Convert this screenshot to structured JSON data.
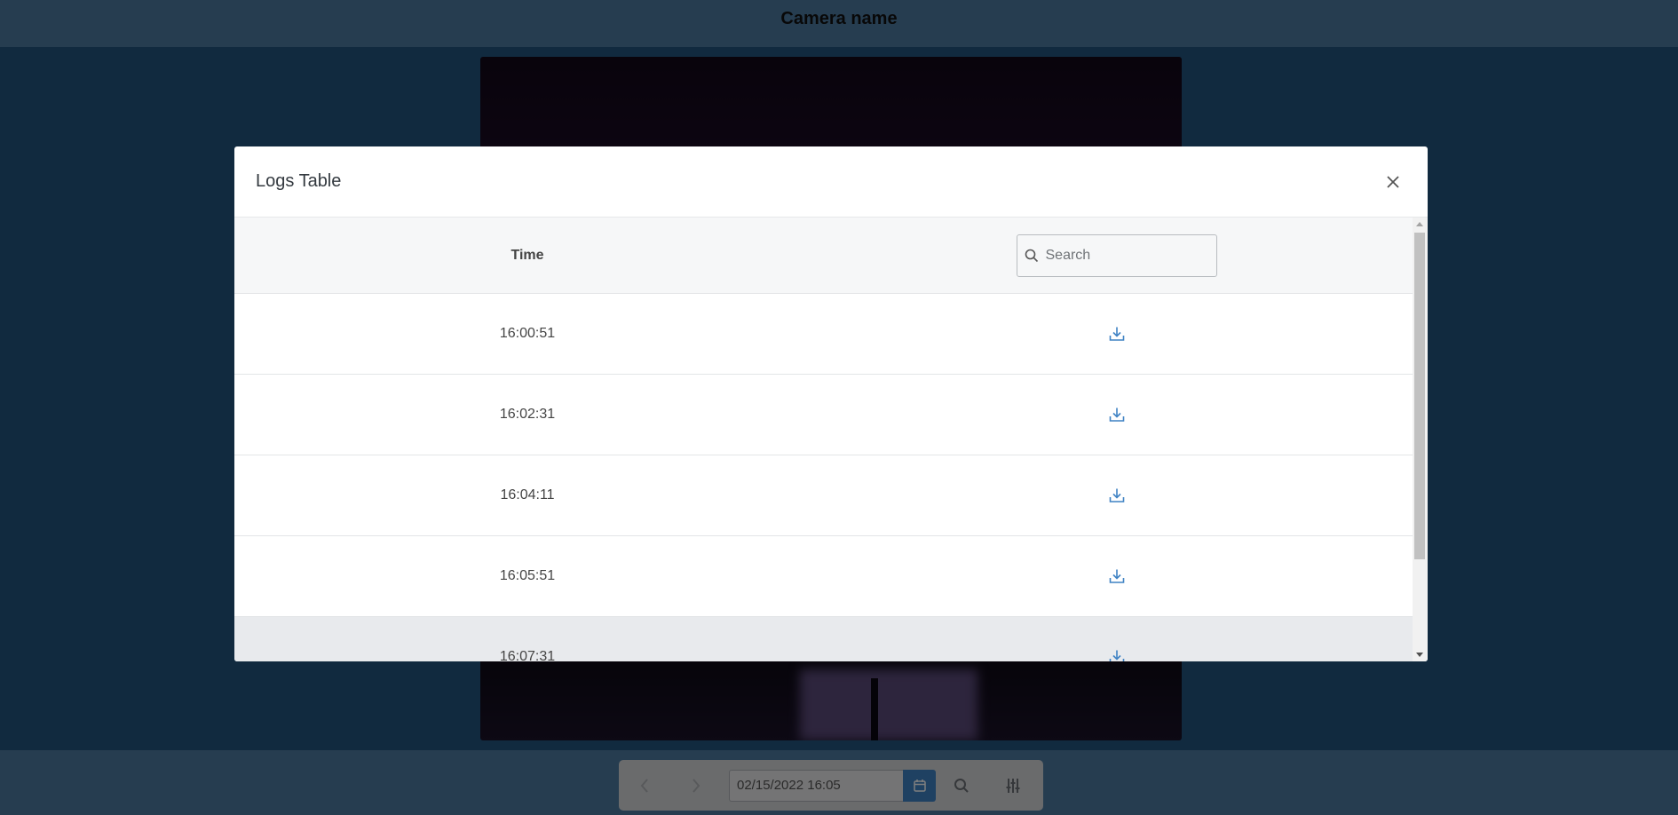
{
  "app": {
    "camera_name": "Camera name"
  },
  "toolbar": {
    "date_value": "02/15/2022 16:05"
  },
  "modal": {
    "title": "Logs Table",
    "column_time": "Time",
    "search_placeholder": "Search",
    "rows": [
      {
        "time": "16:00:51"
      },
      {
        "time": "16:02:31"
      },
      {
        "time": "16:04:11"
      },
      {
        "time": "16:05:51"
      },
      {
        "time": "16:07:31"
      }
    ]
  },
  "icons": {
    "close": "close-icon",
    "search": "search-icon",
    "download": "download-icon",
    "prev": "chevron-left-icon",
    "next": "chevron-right-icon",
    "calendar": "calendar-icon",
    "zoom": "search-icon",
    "settings": "sliders-icon"
  },
  "colors": {
    "accent": "#3f82c4",
    "download_icon": "#3f82c4",
    "header_bg": "#4d7aa1"
  }
}
